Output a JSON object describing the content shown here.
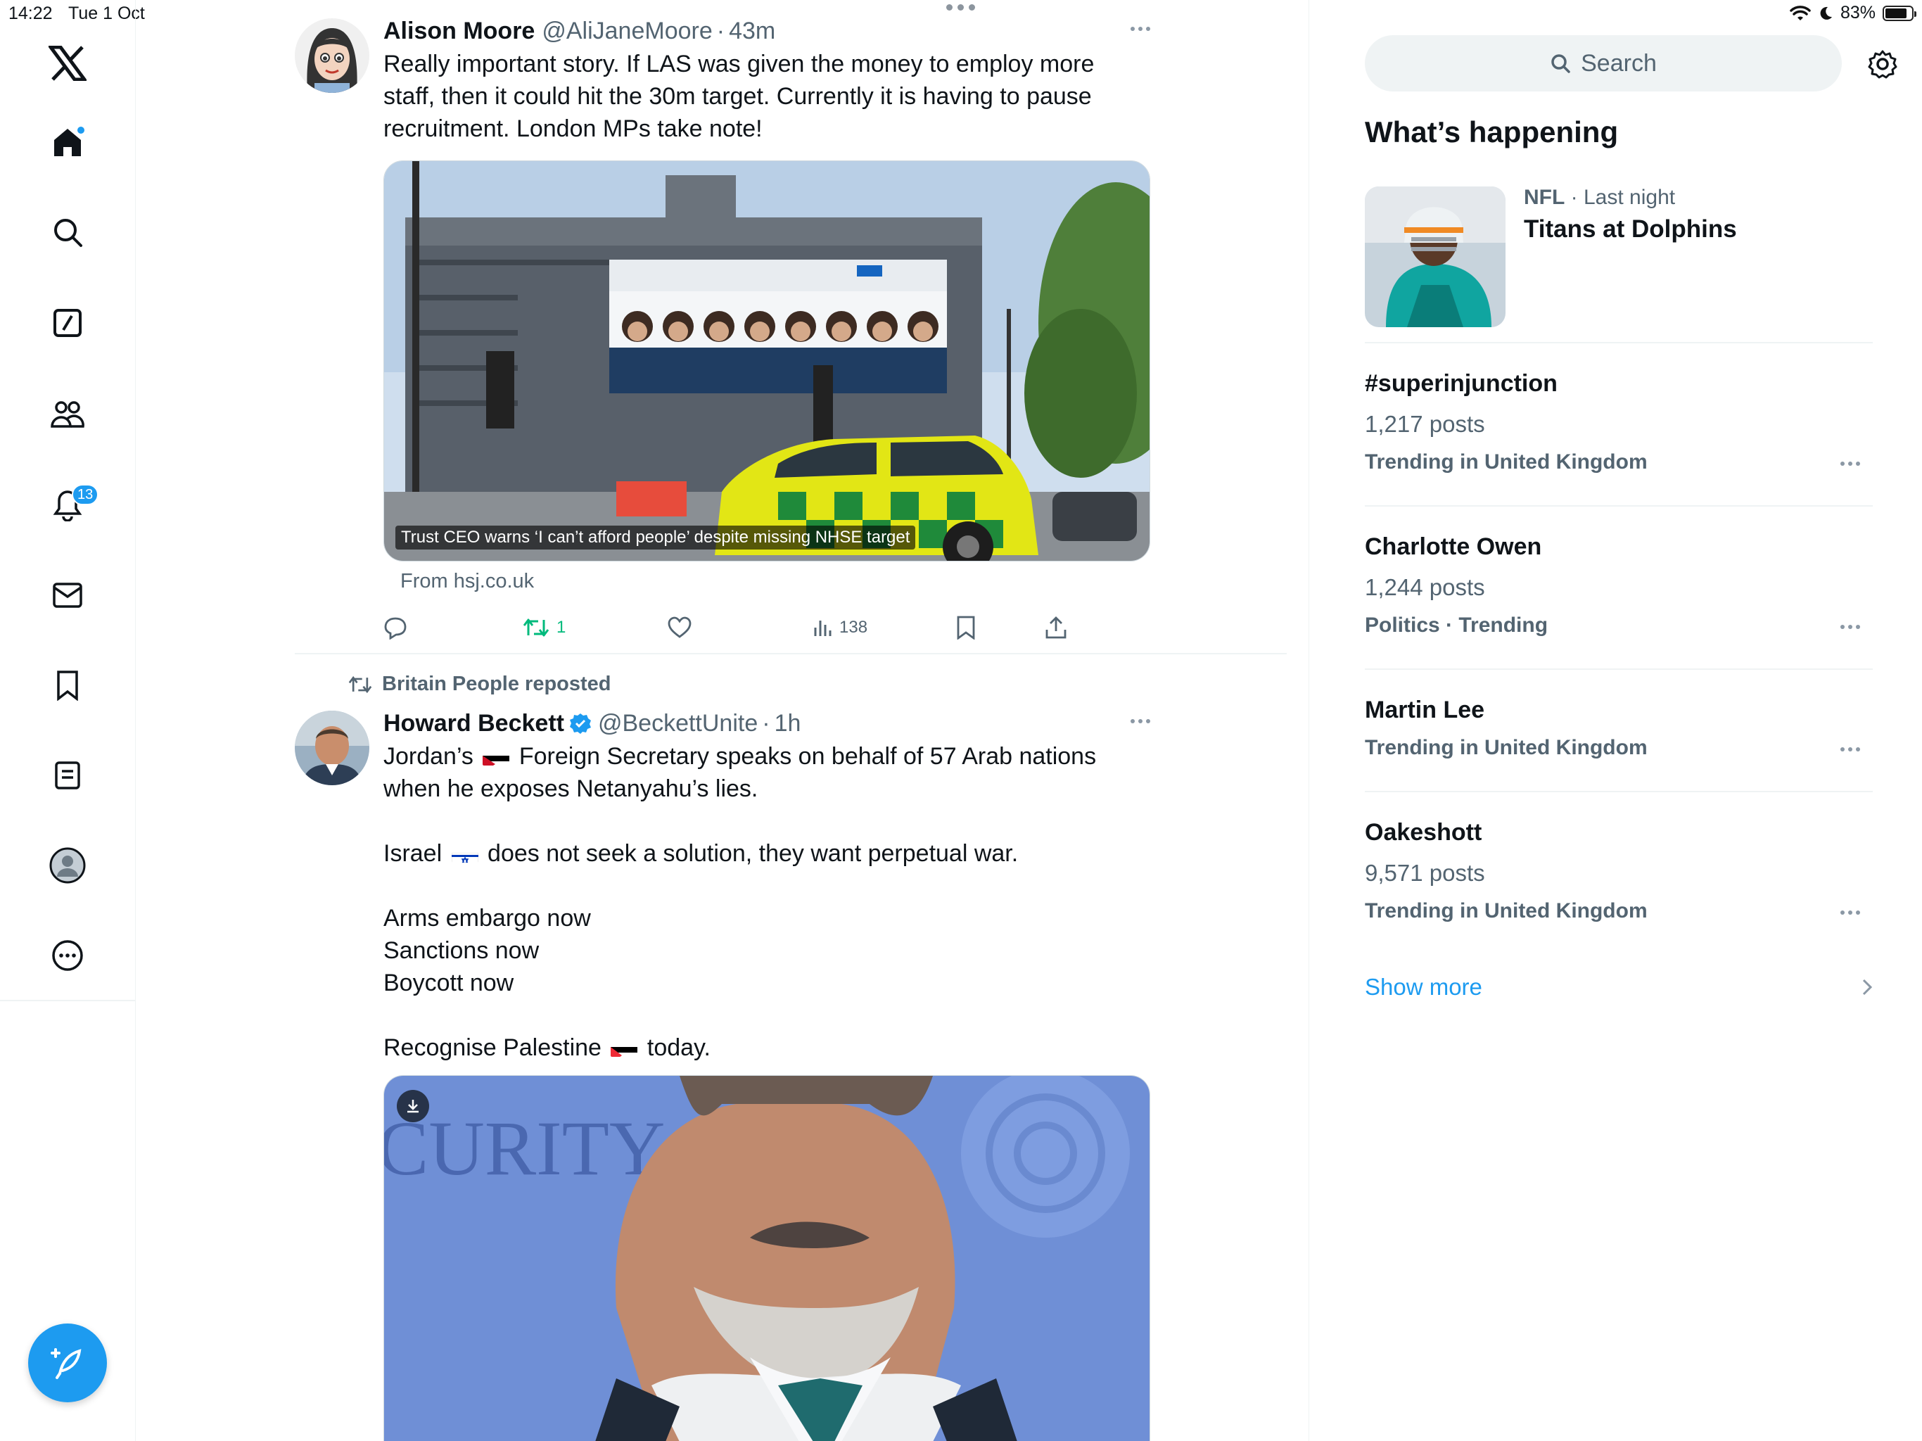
{
  "status": {
    "time": "14:22",
    "date": "Tue 1 Oct",
    "battery": "83%",
    "battery_level": 0.83
  },
  "nav": {
    "items": [
      "X",
      "Home",
      "Explore",
      "Grok",
      "Communities",
      "Notifications",
      "Messages",
      "Bookmarks",
      "Lists",
      "Profile",
      "More"
    ],
    "notifications_count": "13",
    "compose": "Post"
  },
  "tweets": [
    {
      "name": "Alison Moore",
      "handle": "@AliJaneMoore",
      "time": "43m",
      "text": "Really important story. If LAS was given the money to employ more staff, then it could hit the 30m target. Currently it is having to pause recruitment. London MPs take note!",
      "card_caption": "Trust CEO warns ‘I can’t afford people’ despite missing NHSE target",
      "card_from": "From hsj.co.uk",
      "retweets": "1",
      "views": "138"
    },
    {
      "repost_by": "Britain People reposted",
      "name": "Howard Beckett",
      "handle": "@BeckettUnite",
      "time": "1h",
      "line1a": "Jordan’s",
      "line1b": "Foreign Secretary speaks on behalf of 57 Arab nations",
      "line2": "when he exposes Netanyahu’s lies.",
      "line3a": "Israel",
      "line3b": "does not seek a solution, they want perpetual war.",
      "line4": "Arms embargo now",
      "line5": "Sanctions now",
      "line6": "Boycott now",
      "line7a": "Recognise Palestine",
      "line7b": "today.",
      "video_text": "CURITY"
    }
  ],
  "sidebar": {
    "search_placeholder": "Search",
    "heading": "What’s happening",
    "featured": {
      "category": "NFL",
      "time": "Last night",
      "title": "Titans at Dolphins"
    },
    "trends": [
      {
        "title": "#superinjunction",
        "count": "1,217 posts",
        "context": "Trending in United Kingdom"
      },
      {
        "title": "Charlotte Owen",
        "count": "1,244 posts",
        "context": "Politics · Trending"
      },
      {
        "title": "Martin Lee",
        "count": "",
        "context": "Trending in United Kingdom"
      },
      {
        "title": "Oakeshott",
        "count": "9,571 posts",
        "context": "Trending in United Kingdom"
      }
    ],
    "show_more": "Show more"
  },
  "colors": {
    "accent": "#1d9bf0",
    "muted": "#536471",
    "retweet": "#00ba7c"
  }
}
